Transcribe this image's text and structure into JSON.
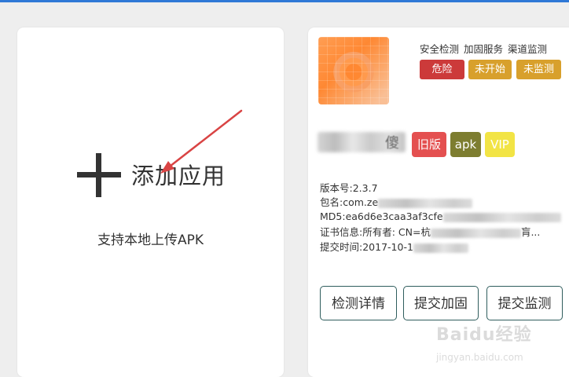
{
  "add_card": {
    "title": "添加应用",
    "hint": "支持本地上传APK"
  },
  "app": {
    "status_headers": [
      "安全检测",
      "加固服务",
      "渠道监测"
    ],
    "status_badges": [
      {
        "label": "危险",
        "color": "#cc3a3a"
      },
      {
        "label": "未开始",
        "color": "#d8a02c"
      },
      {
        "label": "未监测",
        "color": "#d8a02c"
      }
    ],
    "name_visible_char": "傻",
    "tags": [
      {
        "label": "旧版",
        "color": "#e45050"
      },
      {
        "label": "apk",
        "color": "#7d7d30"
      },
      {
        "label": "VIP",
        "color": "#f2e445"
      }
    ],
    "info": {
      "version": "版本号:2.3.7",
      "package": "包名:com.ze",
      "md5": "MD5:ea6d6e3caa3af3cfe",
      "cert": "证书信息:所有者: CN=杭",
      "cert_tail": "肓...",
      "submit_time": "提交时间:2017-10-1"
    },
    "buttons": {
      "detail": "检测详情",
      "harden": "提交加固",
      "monitor": "提交监测"
    }
  },
  "watermark": {
    "brand": "Baidu经验",
    "url": "jingyan.baidu.com"
  },
  "colors": {
    "top_bar": "#2f78d6",
    "arrow": "#d94444",
    "button_border": "#2f5d5d"
  }
}
